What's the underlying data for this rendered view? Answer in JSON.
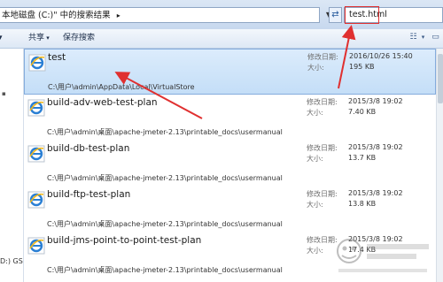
{
  "address": {
    "breadcrumb": "本地磁盘 (C:)\" 中的搜索结果",
    "breadcrumb_arrow": "▸",
    "dropdown_icon": "chevron-down-icon",
    "refresh_icon": "refresh-icon",
    "search_value": "test.html"
  },
  "toolbar": {
    "share_label": "共享",
    "save_search_label": "保存搜索"
  },
  "nav": {
    "drive_label": "D:) GS"
  },
  "results": [
    {
      "name": "test",
      "path": "C:\\用户\\admin\\AppData\\Local\\VirtualStore",
      "modified_label": "修改日期:",
      "modified": "2016/10/26 15:40",
      "size_label": "大小:",
      "size": "195 KB"
    },
    {
      "name": "build-adv-web-test-plan",
      "path": "C:\\用户\\admin\\桌面\\apache-jmeter-2.13\\printable_docs\\usermanual",
      "modified_label": "修改日期:",
      "modified": "2015/3/8 19:02",
      "size_label": "大小:",
      "size": "7.40 KB"
    },
    {
      "name": "build-db-test-plan",
      "path": "C:\\用户\\admin\\桌面\\apache-jmeter-2.13\\printable_docs\\usermanual",
      "modified_label": "修改日期:",
      "modified": "2015/3/8 19:02",
      "size_label": "大小:",
      "size": "13.7 KB"
    },
    {
      "name": "build-ftp-test-plan",
      "path": "C:\\用户\\admin\\桌面\\apache-jmeter-2.13\\printable_docs\\usermanual",
      "modified_label": "修改日期:",
      "modified": "2015/3/8 19:02",
      "size_label": "大小:",
      "size": "13.8 KB"
    },
    {
      "name": "build-jms-point-to-point-test-plan",
      "path": "C:\\用户\\admin\\桌面\\apache-jmeter-2.13\\printable_docs\\usermanual",
      "modified_label": "修改日期:",
      "modified": "2015/3/8 19:02",
      "size_label": "大小:",
      "size": "17.4 KB"
    }
  ],
  "file_icon": "ie-html-icon",
  "colors": {
    "selection": "#c4def7",
    "annotation": "#e03030"
  }
}
